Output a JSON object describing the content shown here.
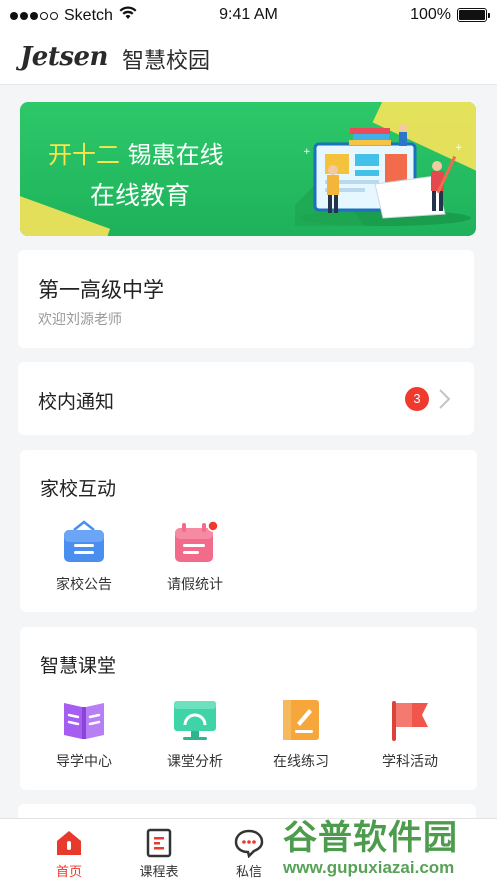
{
  "status_bar": {
    "carrier": "Sketch",
    "time": "9:41 AM",
    "battery": "100%",
    "battery_level": 1.0,
    "signal_bars_filled": 3,
    "signal_bars_total": 5
  },
  "header": {
    "logo": "Jetsen",
    "title": "智慧校园"
  },
  "banner": {
    "line1_highlight": "开十二",
    "line1_rest": "锡惠在线",
    "line2": "在线教育"
  },
  "school": {
    "name": "第一高级中学",
    "welcome": "欢迎刘源老师"
  },
  "notice": {
    "label": "校内通知",
    "badge_count": "3"
  },
  "interaction": {
    "title": "家校互动",
    "items": [
      {
        "label": "家校公告",
        "icon": "announcement-icon",
        "color": "#4a8ef0"
      },
      {
        "label": "请假统计",
        "icon": "calendar-icon",
        "color": "#f26b8a"
      }
    ]
  },
  "classroom": {
    "title": "智慧课堂",
    "items": [
      {
        "label": "导学中心",
        "icon": "book-icon",
        "color": "#a55ef0"
      },
      {
        "label": "课堂分析",
        "icon": "monitor-icon",
        "color": "#3fd4a8"
      },
      {
        "label": "在线练习",
        "icon": "notebook-icon",
        "color": "#f6a63a"
      },
      {
        "label": "学科活动",
        "icon": "flag-icon",
        "color": "#f0564a"
      }
    ]
  },
  "tabs": [
    {
      "label": "首页",
      "icon": "home-icon",
      "active": true
    },
    {
      "label": "课程表",
      "icon": "schedule-icon",
      "active": false
    },
    {
      "label": "私信",
      "icon": "message-icon",
      "active": false
    }
  ],
  "watermark": {
    "text": "谷普软件园",
    "url": "www.gupuxiazai.com"
  },
  "colors": {
    "accent": "#e8392d",
    "banner_green": "#2dc86a",
    "highlight_yellow": "#ffe34a"
  }
}
